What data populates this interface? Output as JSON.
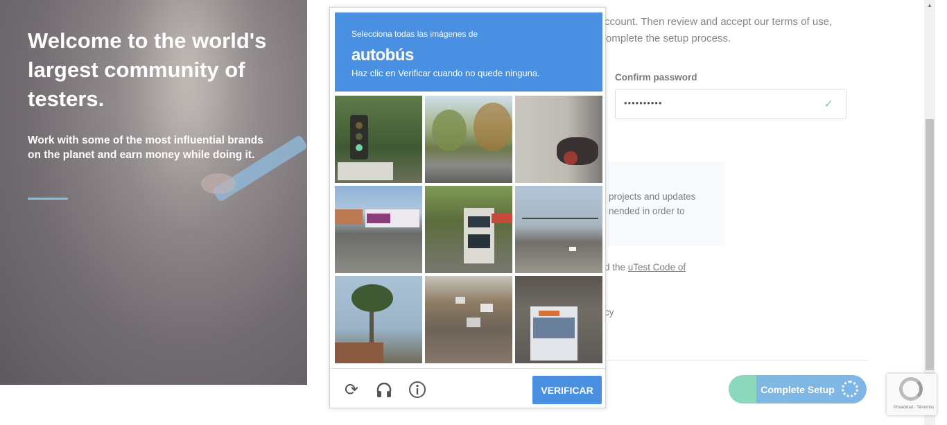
{
  "hero": {
    "title": "Welcome to the world's largest community of testers.",
    "subtitle": "Work with some of the most influential brands on the planet and earn money while doing it."
  },
  "form": {
    "intro_line1": "ccount. Then review and accept our terms of use,",
    "intro_line2": "omplete the setup process.",
    "confirm_label": "Confirm password",
    "confirm_value": "••••••••••",
    "note_text": "projects and updates nended in order to",
    "code_prefix": "d the ",
    "code_link": "uTest Code of",
    "policy_tail": "cy",
    "complete_label": "Complete Setup"
  },
  "captcha": {
    "instruction": "Selecciona todas las imágenes de",
    "target": "autobús",
    "hint": "Haz clic en Verificar cuando no quede ninguna.",
    "verify_label": "VERIFICAR",
    "tiles": [
      "traffic-light",
      "tree-lined-street",
      "motorcycle-wall",
      "white-bus-road",
      "double-decker-bus",
      "city-intersection",
      "palm-tree",
      "highway-traffic",
      "city-bus-front"
    ]
  },
  "badge": {
    "footer": "Privacidad - Términos"
  },
  "colors": {
    "captcha_blue": "#4a90e2",
    "accent_rule": "#7fc3dc",
    "check_green": "#7fc6a0"
  }
}
